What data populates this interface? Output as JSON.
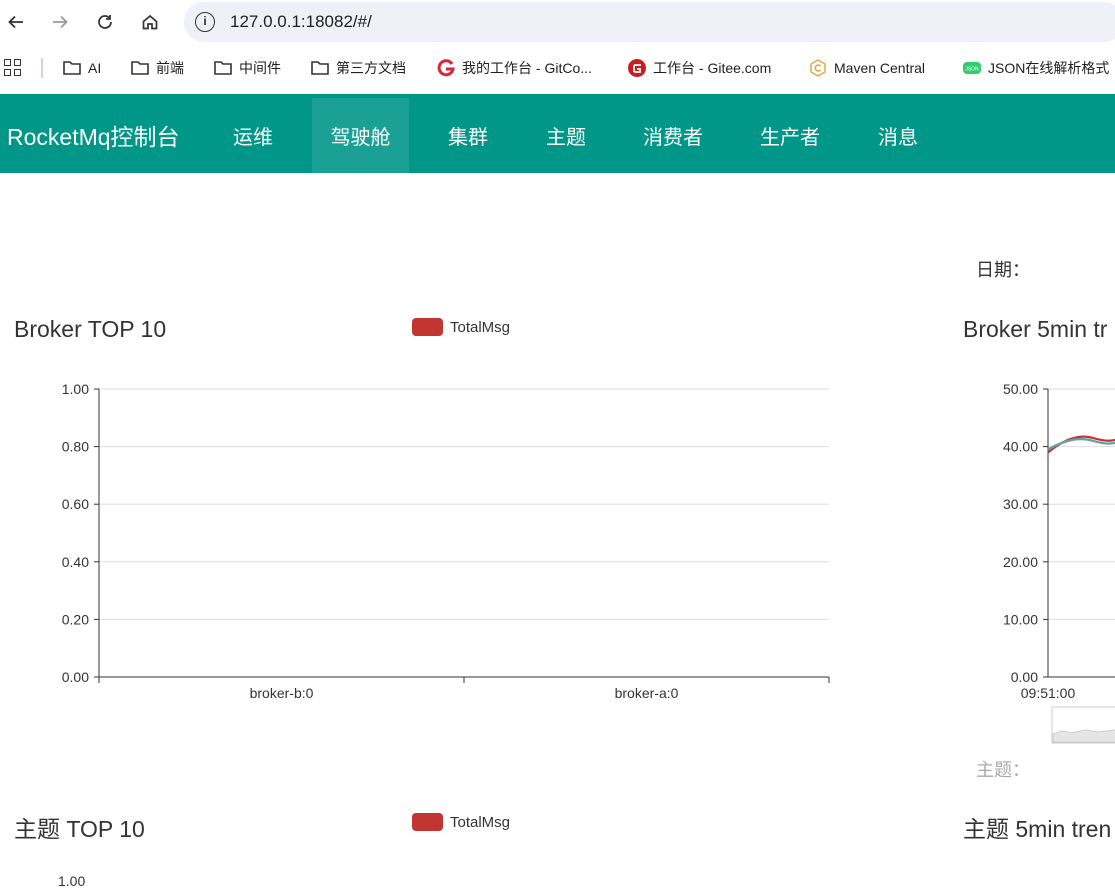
{
  "browser": {
    "url": "127.0.0.1:18082/#/",
    "bookmarks": [
      {
        "label": "AI",
        "icon": "folder-icon"
      },
      {
        "label": "前端",
        "icon": "folder-icon"
      },
      {
        "label": "中间件",
        "icon": "folder-icon"
      },
      {
        "label": "第三方文档",
        "icon": "folder-icon"
      },
      {
        "label": "我的工作台 - GitCo...",
        "icon": "gitcode-icon"
      },
      {
        "label": "工作台 - Gitee.com",
        "icon": "gitee-icon"
      },
      {
        "label": "Maven Central",
        "icon": "maven-icon"
      },
      {
        "label": "JSON在线解析格式",
        "icon": "json-icon"
      }
    ]
  },
  "app": {
    "brand": "RocketMq控制台",
    "nav": [
      {
        "label": "运维",
        "active": false
      },
      {
        "label": "驾驶舱",
        "active": true
      },
      {
        "label": "集群",
        "active": false
      },
      {
        "label": "主题",
        "active": false
      },
      {
        "label": "消费者",
        "active": false
      },
      {
        "label": "生产者",
        "active": false
      },
      {
        "label": "消息",
        "active": false
      }
    ],
    "accent": "#009688"
  },
  "dashboard": {
    "date_label": "日期：",
    "topic_label": "主题：",
    "broker_top_title": "Broker TOP 10",
    "broker_trend_title": "Broker 5min tr",
    "topic_top_title": "主题 TOP 10",
    "topic_trend_title": "主题 5min tren",
    "legend_total": "TotalMsg",
    "partial_tick": "1.00"
  },
  "chart_data": [
    {
      "type": "bar",
      "title": "Broker TOP 10",
      "categories": [
        "broker-b:0",
        "broker-a:0"
      ],
      "series": [
        {
          "name": "TotalMsg",
          "values": [
            0,
            0
          ],
          "color": "#c23531"
        }
      ],
      "ylim": [
        0,
        1
      ],
      "yticks": [
        "0.00",
        "0.20",
        "0.40",
        "0.60",
        "0.80",
        "1.00"
      ],
      "grid": true,
      "legend": "top"
    },
    {
      "type": "line",
      "title": "Broker 5min tr",
      "x": [
        "09:51:00"
      ],
      "series": [
        {
          "values": [
            39,
            41.5
          ],
          "color": "#c23531"
        },
        {
          "values": [
            39.5,
            41
          ],
          "color": "#61a0a8"
        }
      ],
      "ylim": [
        0,
        50
      ],
      "yticks": [
        "0.00",
        "10.00",
        "20.00",
        "30.00",
        "40.00",
        "50.00"
      ],
      "grid": true
    }
  ]
}
